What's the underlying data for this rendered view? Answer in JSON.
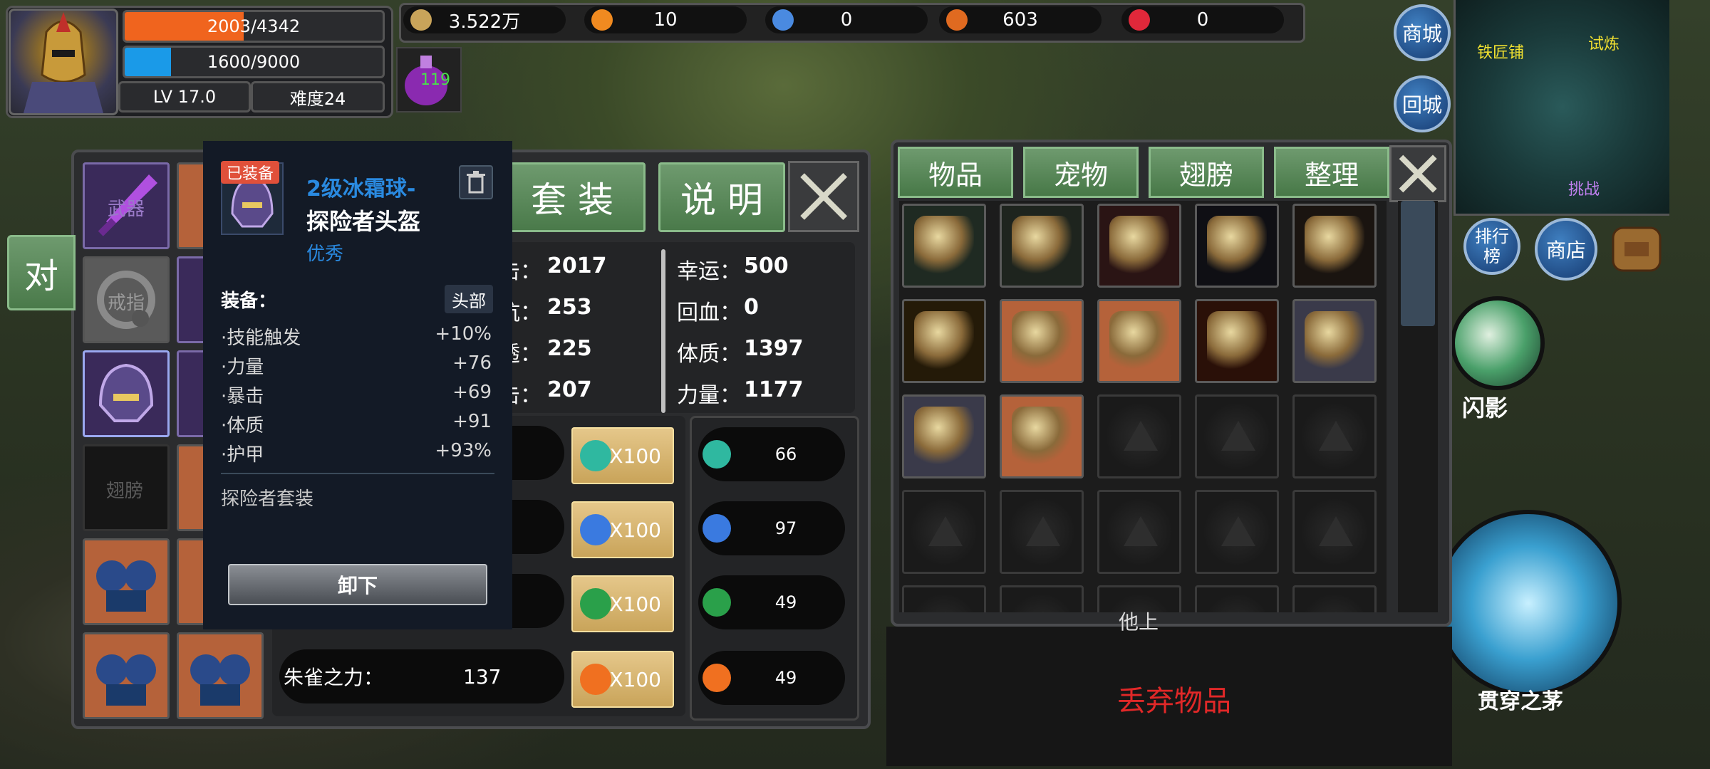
{
  "player": {
    "hp_text": "2003/4342",
    "hp_fraction": 0.46,
    "mp_text": "1600/9000",
    "mp_fraction": 0.18,
    "level": "LV   17.0",
    "difficulty": "难度24",
    "potion_count": "119"
  },
  "resources": [
    {
      "icon": "copper-coin-icon",
      "value": "3.522万",
      "color": "#c9a45a"
    },
    {
      "icon": "flame-feather-icon",
      "value": "10",
      "color": "#f08a20"
    },
    {
      "icon": "blue-feather-icon",
      "value": "0",
      "color": "#4a8ae0"
    },
    {
      "icon": "running-man-icon",
      "value": "603",
      "color": "#e06a20"
    },
    {
      "icon": "heart-icon",
      "value": "0",
      "color": "#e0283a"
    }
  ],
  "right_buttons": {
    "mall": "商城",
    "return_city": "回城",
    "ranking": "排行榜",
    "shop": "商店"
  },
  "minimap": {
    "blacksmith": "铁匠铺",
    "trial": "试炼",
    "challenge": "挑战"
  },
  "skills": {
    "shadow_flash": "闪影",
    "piercing_spear": "贯穿之茅"
  },
  "equipment": {
    "left_slots": {
      "weapon": "武器",
      "ring": "戒指",
      "wings": "翅膀"
    },
    "dialogue_button_partial": "对",
    "suit_button": "套 装",
    "explain_button": "说 明",
    "stats_left_partial": [
      {
        "label": "击：",
        "value": "2017"
      },
      {
        "label": "抗：",
        "value": "253"
      },
      {
        "label": "透：",
        "value": "225"
      },
      {
        "label": "击：",
        "value": "207"
      }
    ],
    "stats_right": [
      {
        "label": "幸运：",
        "value": "500"
      },
      {
        "label": "回血：",
        "value": "0"
      },
      {
        "label": "体质：",
        "value": "1397"
      },
      {
        "label": "力量：",
        "value": "1177"
      }
    ],
    "gems": [
      {
        "icon": "teal-dragon-gem-icon",
        "cost": "X100",
        "count": "66",
        "color": "#2fb8a0"
      },
      {
        "icon": "blue-crystal-gem-icon",
        "cost": "X100",
        "count": "97",
        "color": "#3a7ae0"
      },
      {
        "icon": "green-emerald-gem-icon",
        "cost": "X100",
        "count": "49",
        "color": "#2aa04a"
      },
      {
        "icon": "orange-flame-gem-icon",
        "cost": "X100",
        "count": "49",
        "color": "#f07020"
      }
    ],
    "power_label": "朱雀之力：",
    "power_value": "137"
  },
  "tooltip": {
    "badge": "已装备",
    "name_line1": "2级冰霜球-",
    "name_line2": "探险者头盔",
    "quality": "优秀",
    "section_label": "装备：",
    "slot_tag": "头部",
    "attributes": [
      {
        "name": "·技能触发",
        "value": "+10%"
      },
      {
        "name": "·力量",
        "value": "+76"
      },
      {
        "name": "·暴击",
        "value": "+69"
      },
      {
        "name": "·体质",
        "value": "+91"
      },
      {
        "name": "·护甲",
        "value": "+93%"
      }
    ],
    "set_name": "探险者套装",
    "unequip_button": "卸下"
  },
  "inventory": {
    "tabs": [
      "物品",
      "宠物",
      "翅膀",
      "整理"
    ],
    "drop_label": "丢弃物品",
    "partial_label": "他上",
    "items": [
      {
        "icon": "green-armor-icon",
        "bg": "#1f2a22"
      },
      {
        "icon": "hooded-cloak-icon",
        "bg": "#1e241e"
      },
      {
        "icon": "fire-boots-icon",
        "bg": "#2a1414"
      },
      {
        "icon": "golden-sword-icon",
        "bg": "#0f0f14"
      },
      {
        "icon": "winged-boots-icon",
        "bg": "#1a1410"
      },
      {
        "icon": "golden-helmet-icon",
        "bg": "#241a08"
      },
      {
        "icon": "gold-ring-icon",
        "bg": "#b5623a"
      },
      {
        "icon": "iron-helmet-icon",
        "bg": "#b5623a"
      },
      {
        "icon": "flame-helmet-icon",
        "bg": "#2a1008"
      },
      {
        "icon": "purple-ribbon-icon",
        "bg": "#3a3a4a"
      },
      {
        "icon": "purple-ribbon-icon",
        "bg": "#3a3a4a"
      },
      {
        "icon": "purple-gauntlet-icon",
        "bg": "#b5623a"
      }
    ]
  }
}
